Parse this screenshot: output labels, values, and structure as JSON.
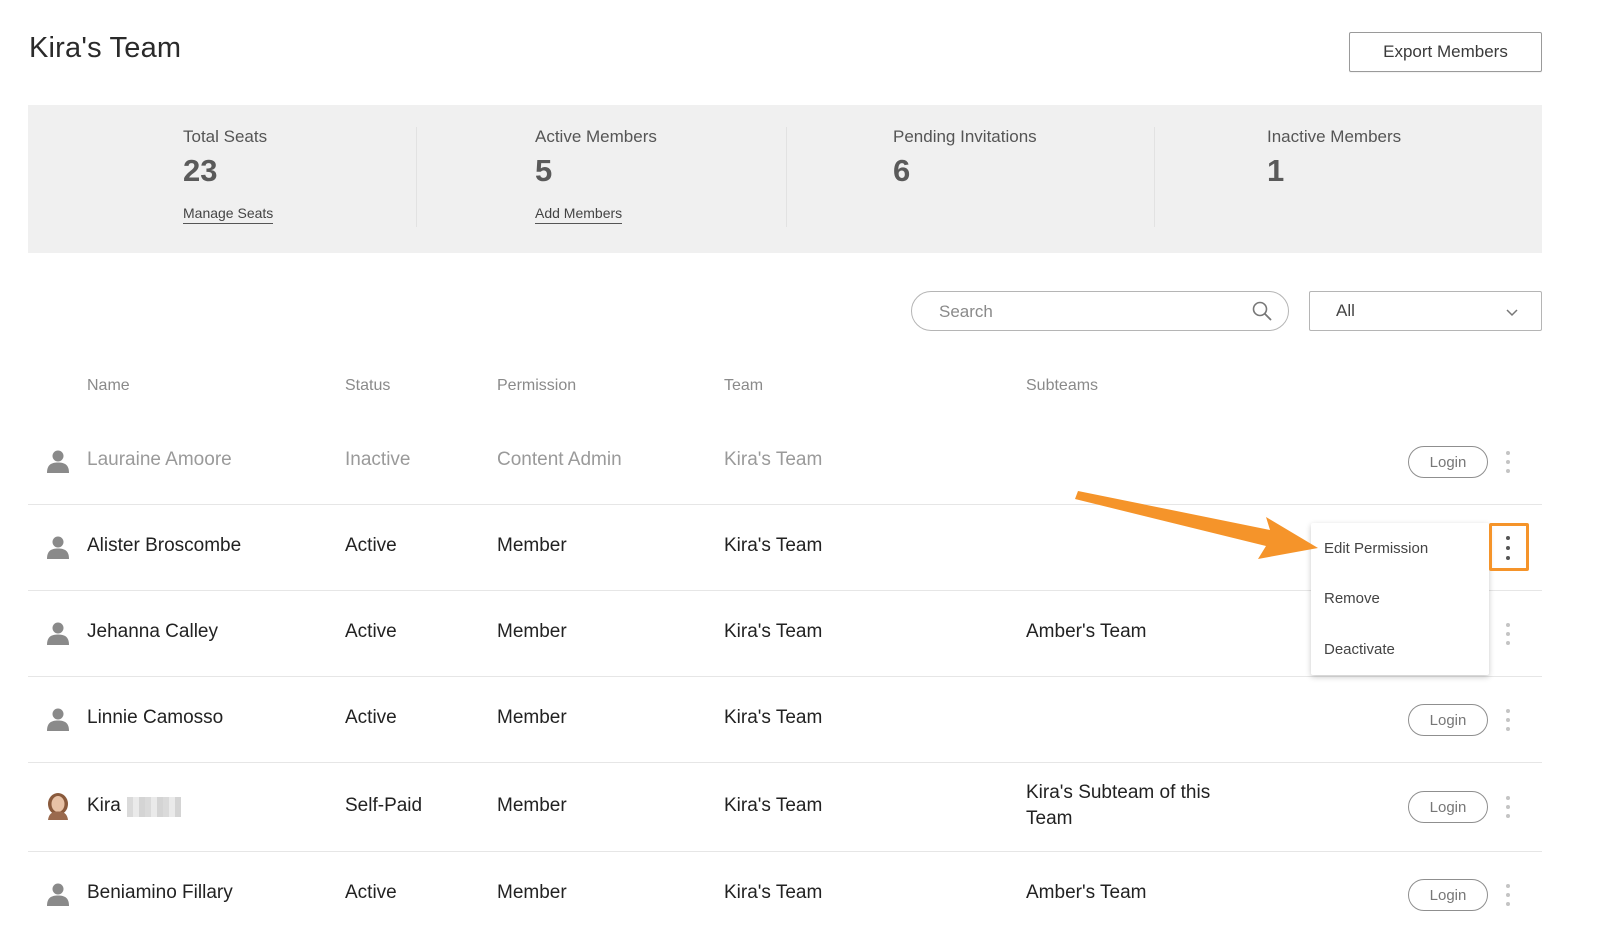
{
  "header": {
    "title": "Kira's Team",
    "export_label": "Export Members"
  },
  "stats": [
    {
      "label": "Total Seats",
      "value": "23",
      "link": "Manage Seats"
    },
    {
      "label": "Active Members",
      "value": "5",
      "link": "Add Members"
    },
    {
      "label": "Pending Invitations",
      "value": "6",
      "link": ""
    },
    {
      "label": "Inactive Members",
      "value": "1",
      "link": ""
    }
  ],
  "search": {
    "placeholder": "Search",
    "icon": "search-icon"
  },
  "filter": {
    "selected": "All",
    "icon": "chevron-down-icon"
  },
  "table": {
    "columns": [
      "Name",
      "Status",
      "Permission",
      "Team",
      "Subteams"
    ],
    "rows": [
      {
        "name": "Lauraine Amoore",
        "status": "Inactive",
        "permission": "Content Admin",
        "team": "Kira's Team",
        "subteams": "",
        "action": "Login"
      },
      {
        "name": "Alister Broscombe",
        "status": "Active",
        "permission": "Member",
        "team": "Kira's Team",
        "subteams": "",
        "action": ""
      },
      {
        "name": "Jehanna Calley",
        "status": "Active",
        "permission": "Member",
        "team": "Kira's Team",
        "subteams": "Amber's Team",
        "action": ""
      },
      {
        "name": "Linnie Camosso",
        "status": "Active",
        "permission": "Member",
        "team": "Kira's Team",
        "subteams": "",
        "action": "Login"
      },
      {
        "name": "Kira",
        "status": "Self-Paid",
        "permission": "Member",
        "team": "Kira's Team",
        "subteams_line1": "Kira's Subteam of this",
        "subteams_line2": "Team",
        "action": "Login"
      },
      {
        "name": "Beniamino Fillary",
        "status": "Active",
        "permission": "Member",
        "team": "Kira's Team",
        "subteams": "Amber's Team",
        "action": "Login"
      }
    ]
  },
  "menu": {
    "items": [
      "Edit Permission",
      "Remove",
      "Deactivate"
    ]
  },
  "colors": {
    "accent": "#f5942a",
    "stats_bg": "#f0f0f0"
  }
}
